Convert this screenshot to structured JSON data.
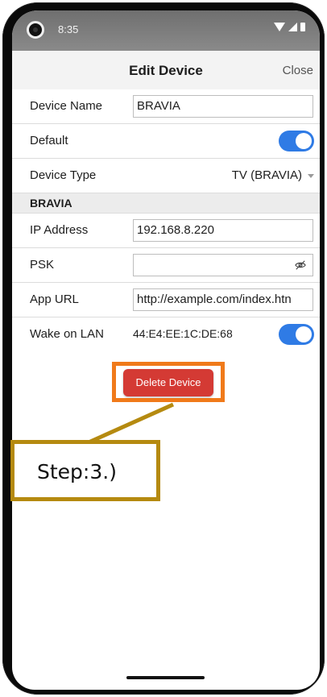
{
  "status_bar": {
    "time": "8:35"
  },
  "header": {
    "title": "Edit Device",
    "close_label": "Close"
  },
  "fields": {
    "device_name_label": "Device Name",
    "device_name_value": "BRAVIA",
    "default_label": "Default",
    "default_on": true,
    "device_type_label": "Device Type",
    "device_type_value": "TV (BRAVIA)"
  },
  "section": {
    "title": "BRAVIA",
    "ip_label": "IP Address",
    "ip_value": "192.168.8.220",
    "psk_label": "PSK",
    "psk_value": "",
    "app_url_label": "App URL",
    "app_url_value": "http://example.com/index.htn",
    "wol_label": "Wake on LAN",
    "wol_mac": "44:E4:EE:1C:DE:68",
    "wol_on": true
  },
  "actions": {
    "delete_label": "Delete Device"
  },
  "annotation": {
    "step_text": "Step:3.)"
  },
  "colors": {
    "toggle_on": "#2f7be5",
    "delete": "#d43a34",
    "highlight_orange": "#f07a1a",
    "callout_gold": "#b58a10"
  },
  "icons": {
    "eye": "eye-off-icon"
  }
}
